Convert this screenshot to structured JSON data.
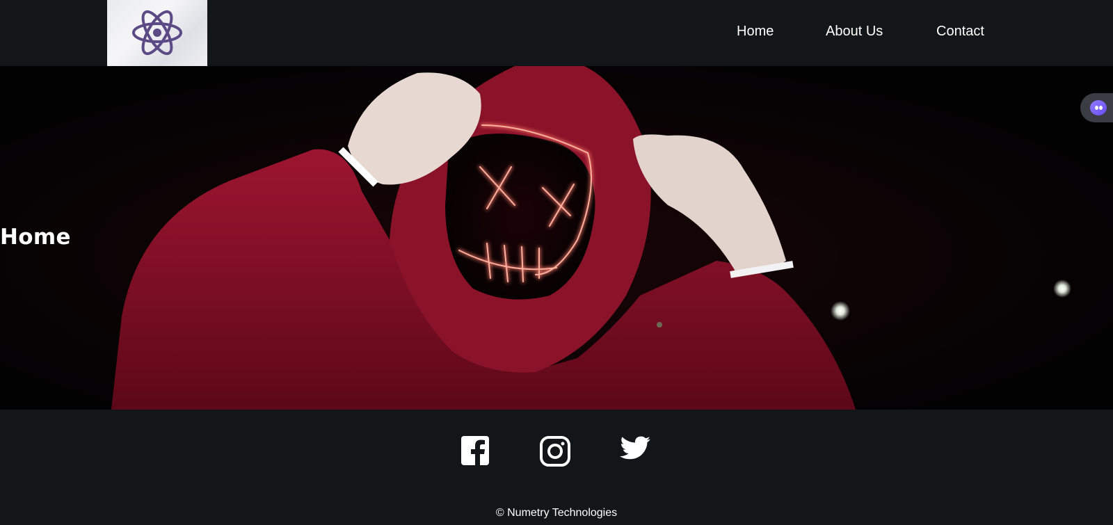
{
  "navbar": {
    "logo_icon": "react-atom-icon",
    "links": [
      {
        "label": "Home"
      },
      {
        "label": "About Us"
      },
      {
        "label": "Contact"
      }
    ]
  },
  "hero": {
    "title": "Home",
    "image": "person-in-red-hoodie-with-neon-mask"
  },
  "chat_widget": {
    "icon": "chat-bot-icon"
  },
  "footer": {
    "social": [
      {
        "icon": "facebook-icon"
      },
      {
        "icon": "instagram-icon"
      },
      {
        "icon": "twitter-icon"
      }
    ],
    "copyright": "© Numetry Technologies"
  },
  "colors": {
    "background": "#121619",
    "text": "#ffffff",
    "accent_red": "#b0102e",
    "neon": "#ff7a6a",
    "logo_purple": "#5b4a86"
  }
}
